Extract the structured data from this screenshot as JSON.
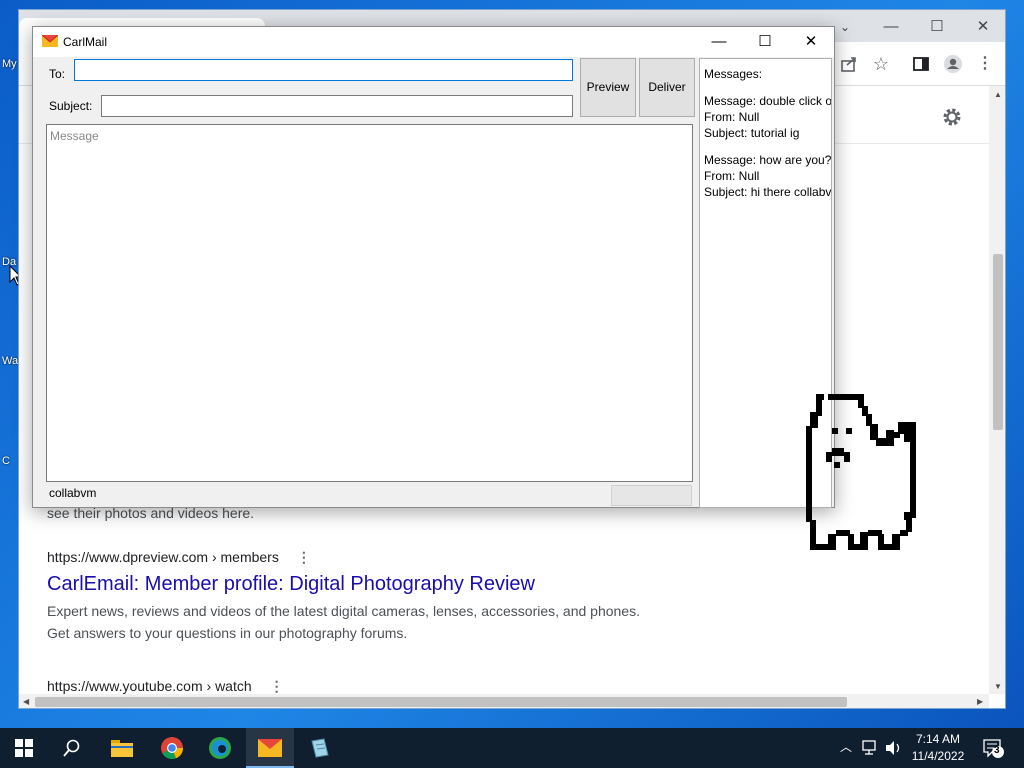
{
  "desktop": {
    "icon_labels": [
      "My",
      "Da",
      "Wa",
      "C"
    ]
  },
  "browser": {
    "results": [
      {
        "url": "https://www.dpreview.com › members",
        "title": "CarlEmail: Member profile: Digital Photography Review",
        "snippet_line1": "Expert news, reviews and videos of the latest digital cameras, lenses, accessories, and phones.",
        "snippet_line2": "Get answers to your questions in our photography forums."
      },
      {
        "url": "https://www.youtube.com › watch"
      }
    ],
    "partial_text": "see their photos and videos here."
  },
  "carlmail": {
    "title": "CarlMail",
    "to_label": "To:",
    "to_value": "",
    "subject_label": "Subject:",
    "subject_value": "",
    "message_placeholder": "Message",
    "preview_label": "Preview",
    "deliver_label": "Deliver",
    "status_text": "collabvm",
    "messages_header": "Messages:",
    "messages": [
      {
        "message": "Message: double click o",
        "from": "From: Null",
        "subject": "Subject: tutorial ig"
      },
      {
        "message": "Message: how are you? t",
        "from": "From: Null",
        "subject": "Subject: hi there collabv"
      }
    ]
  },
  "taskbar": {
    "time": "7:14 AM",
    "date": "11/4/2022",
    "notification_count": "3"
  },
  "colors": {
    "link": "#1a0dab",
    "taskbar": "#101f30",
    "desktop": "#1f86e6"
  }
}
